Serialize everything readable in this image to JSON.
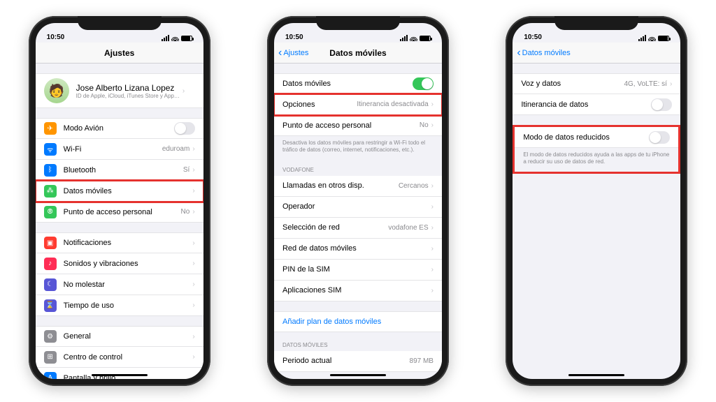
{
  "status": {
    "time": "10:50"
  },
  "colors": {
    "accent": "#007aff",
    "highlight": "#e5322e"
  },
  "phone1": {
    "title": "Ajustes",
    "profile": {
      "name": "Jose Alberto Lizana Lopez",
      "sub": "ID de Apple, iCloud, iTunes Store y App…"
    },
    "g1": [
      {
        "icon": "airplane-icon",
        "color": "ic-orange",
        "glyph": "✈",
        "label": "Modo Avión",
        "toggle": false
      },
      {
        "icon": "wifi-icon",
        "color": "ic-blue",
        "glyph": "⌔",
        "label": "Wi-Fi",
        "detail": "eduroam",
        "chev": true
      },
      {
        "icon": "bluetooth-icon",
        "color": "ic-blue",
        "glyph": "⌘",
        "label": "Bluetooth",
        "detail": "Sí",
        "chev": true
      },
      {
        "icon": "cellular-icon",
        "color": "ic-green",
        "glyph": "⍑",
        "label": "Datos móviles",
        "chev": true,
        "hl": true
      },
      {
        "icon": "hotspot-icon",
        "color": "ic-green",
        "glyph": "⎋",
        "label": "Punto de acceso personal",
        "detail": "No",
        "chev": true
      }
    ],
    "g2": [
      {
        "icon": "notif-icon",
        "color": "ic-red",
        "glyph": "▣",
        "label": "Notificaciones",
        "chev": true
      },
      {
        "icon": "sound-icon",
        "color": "ic-pink",
        "glyph": "♪",
        "label": "Sonidos y vibraciones",
        "chev": true
      },
      {
        "icon": "dnd-icon",
        "color": "ic-indigo",
        "glyph": "☾",
        "label": "No molestar",
        "chev": true
      },
      {
        "icon": "screentime-icon",
        "color": "ic-indigo",
        "glyph": "⌛",
        "label": "Tiempo de uso",
        "chev": true
      }
    ],
    "g3": [
      {
        "icon": "general-icon",
        "color": "ic-gray",
        "glyph": "⚙",
        "label": "General",
        "chev": true
      },
      {
        "icon": "control-icon",
        "color": "ic-gray",
        "glyph": "⊞",
        "label": "Centro de control",
        "chev": true
      },
      {
        "icon": "display-icon",
        "color": "ic-blue",
        "glyph": "A",
        "label": "Pantalla y brillo",
        "chev": true
      }
    ]
  },
  "phone2": {
    "back": "Ajustes",
    "title": "Datos móviles",
    "g1": [
      {
        "label": "Datos móviles",
        "toggle": true
      },
      {
        "label": "Opciones",
        "detail": "Itinerancia desactivada",
        "chev": true,
        "hl": true
      },
      {
        "label": "Punto de acceso personal",
        "detail": "No",
        "chev": true
      }
    ],
    "g1_footer": "Desactiva los datos móviles para restringir a Wi-Fi todo el tráfico de datos (correo, internet, notificaciones, etc.).",
    "g2_header": "VODAFONE",
    "g2": [
      {
        "label": "Llamadas en otros disp.",
        "detail": "Cercanos",
        "chev": true
      },
      {
        "label": "Operador",
        "chev": true
      },
      {
        "label": "Selección de red",
        "detail": "vodafone ES",
        "chev": true
      },
      {
        "label": "Red de datos móviles",
        "chev": true
      },
      {
        "label": "PIN de la SIM",
        "chev": true
      },
      {
        "label": "Aplicaciones SIM",
        "chev": true
      }
    ],
    "add_plan": "Añadir plan de datos móviles",
    "g3_header": "DATOS MÓVILES",
    "g3": [
      {
        "label": "Periodo actual",
        "detail": "897 MB"
      }
    ]
  },
  "phone3": {
    "back": "Datos móviles",
    "g1": [
      {
        "label": "Voz y datos",
        "detail": "4G, VoLTE: sí",
        "chev": true
      },
      {
        "label": "Itinerancia de datos",
        "toggle": false
      }
    ],
    "g2": [
      {
        "label": "Modo de datos reducidos",
        "toggle": false
      }
    ],
    "g2_footer": "El modo de datos reducidos ayuda a las apps de tu iPhone a reducir su uso de datos de red."
  }
}
